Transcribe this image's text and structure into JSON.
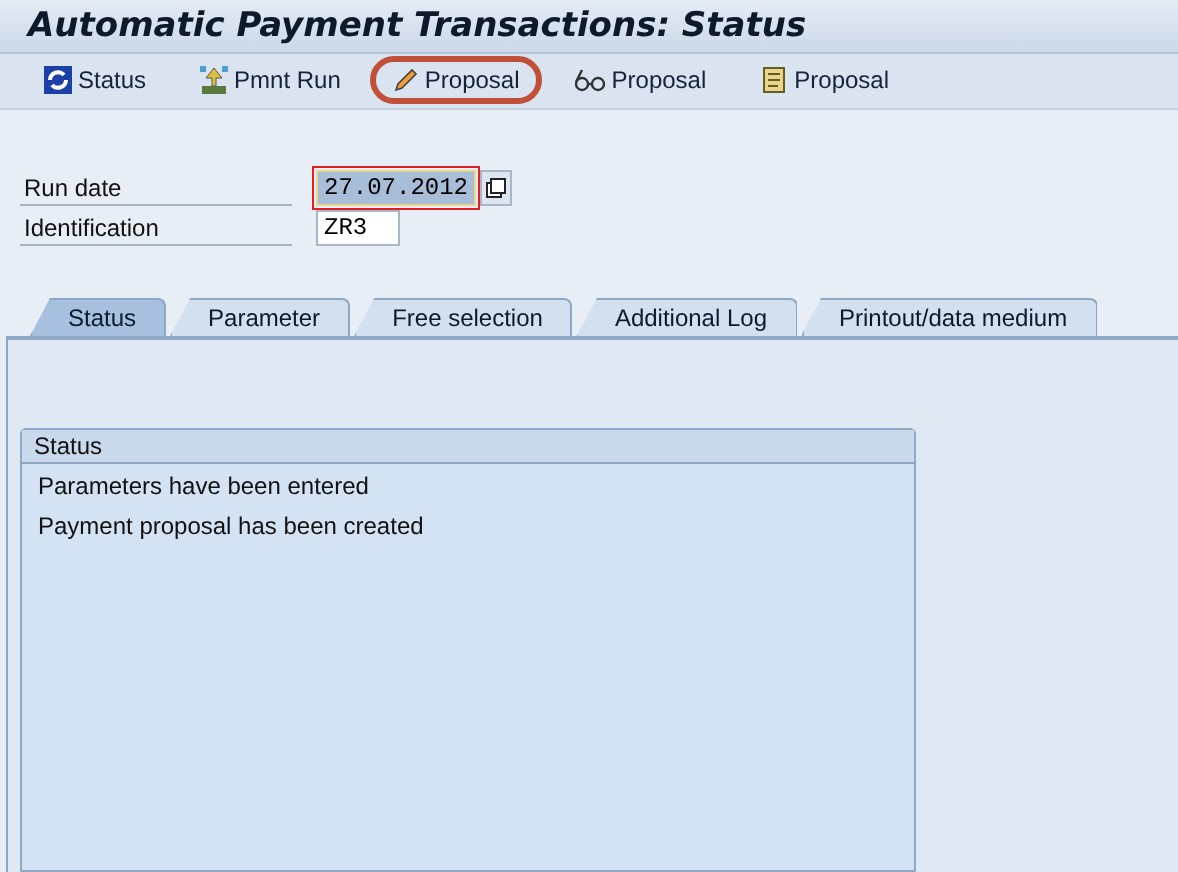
{
  "window": {
    "title": "Automatic Payment Transactions: Status"
  },
  "toolbar": [
    {
      "kind": "refresh",
      "label": "Status",
      "highlighted": false
    },
    {
      "kind": "run",
      "label": "Pmnt Run",
      "highlighted": false
    },
    {
      "kind": "pencil",
      "label": "Proposal",
      "highlighted": true
    },
    {
      "kind": "glasses",
      "label": "Proposal",
      "highlighted": false
    },
    {
      "kind": "scroll",
      "label": "Proposal",
      "highlighted": false
    }
  ],
  "fields": [
    {
      "label": "Run date",
      "value": "27.07.2012",
      "focused": true,
      "has_picker": true
    },
    {
      "label": "Identification",
      "value": "ZR3",
      "focused": false,
      "has_picker": false
    }
  ],
  "tabs": [
    {
      "label": "Status",
      "selected": true
    },
    {
      "label": "Parameter",
      "selected": false
    },
    {
      "label": "Free selection",
      "selected": false
    },
    {
      "label": "Additional Log",
      "selected": false
    },
    {
      "label": "Printout/data medium",
      "selected": false
    }
  ],
  "status_box": {
    "title": "Status",
    "messages": [
      "Parameters have been entered",
      "Payment proposal has been created"
    ]
  }
}
